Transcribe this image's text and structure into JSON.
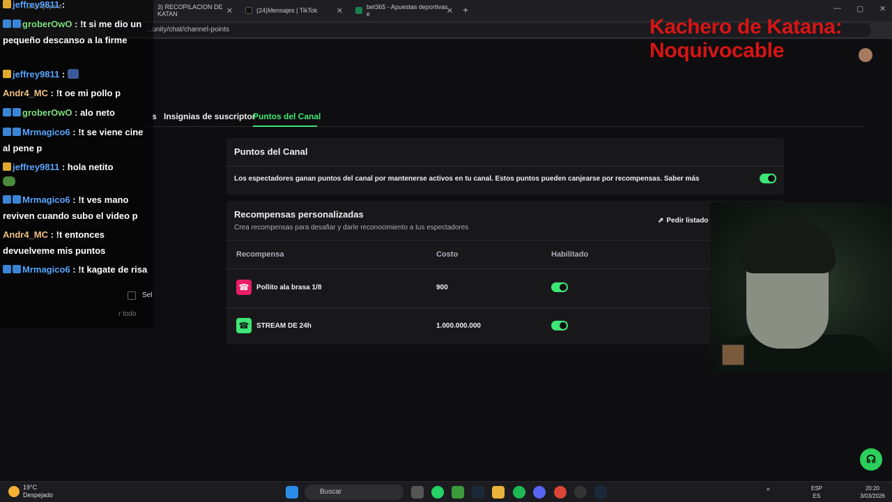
{
  "browser": {
    "tabs": [
      {
        "label": "3) RECOPILACION DE KATAN"
      },
      {
        "label": "(24)Mensajes | TikTok"
      },
      {
        "label": "bet365 - Apuestas deportivas e"
      }
    ],
    "new_tab": "+",
    "address": "...unity/chat/channel-points",
    "popout_address": "...com/popout"
  },
  "overlay": {
    "title_line1": "Kachero de Katana:",
    "title_line2": "Noquivocable"
  },
  "chat": {
    "messages": [
      {
        "user": "jeffrey9811",
        "text": ":"
      },
      {
        "user": "groberOwO",
        "text": ": !t si me dio un pequeño descanso a la firme"
      },
      {
        "user": "jeffrey9811",
        "text": ":"
      },
      {
        "user": "Andr4_MC",
        "text": ": !t oe mi pollo p"
      },
      {
        "user": "groberOwO",
        "text": ": alo neto"
      },
      {
        "user": "Mrmagico6",
        "text": ": !t se viene cine al pene p"
      },
      {
        "user": "jeffrey9811",
        "text": ": hola netito"
      },
      {
        "user": "Mrmagico6",
        "text": ": !t ves mano reviven cuando subo el video p"
      },
      {
        "user": "Andr4_MC",
        "text": ": !t entonces devuelveme mis puntos"
      },
      {
        "user": "Mrmagico6",
        "text": ": !t kagate de risa"
      }
    ],
    "select_label": "Sel",
    "select_all": "r todo"
  },
  "subnav": {
    "partial": "s",
    "tab1": "Insignias de suscriptor",
    "tab2": "Puntos del Canal"
  },
  "channel_points": {
    "title": "Puntos del Canal",
    "description": "Los espectadores ganan puntos del canal por mantenerse activos en tu canal. Estos puntos pueden canjearse por recompensas. Saber más",
    "enabled": true
  },
  "rewards": {
    "title": "Recompensas personalizadas",
    "subtitle": "Crea recompensas para desafiar y darle reconocimiento a tus espectadores",
    "request_button": "Pedir listado",
    "columns": [
      "Recompensa",
      "Costo",
      "Habilitado"
    ],
    "rows": [
      {
        "name": "Pollito ala brasa 1/8",
        "cost": "900",
        "enabled": true,
        "color": "#e91e63"
      },
      {
        "name": "STREAM DE 24h",
        "cost": "1.000.000.000",
        "enabled": true,
        "color": "#3ee675"
      }
    ]
  },
  "taskbar": {
    "temp": "19°C",
    "weather": "Despejado",
    "search": "Buscar",
    "lang1": "ESP",
    "lang2": "ES",
    "time": "20:20",
    "date": "3/03/2026"
  }
}
